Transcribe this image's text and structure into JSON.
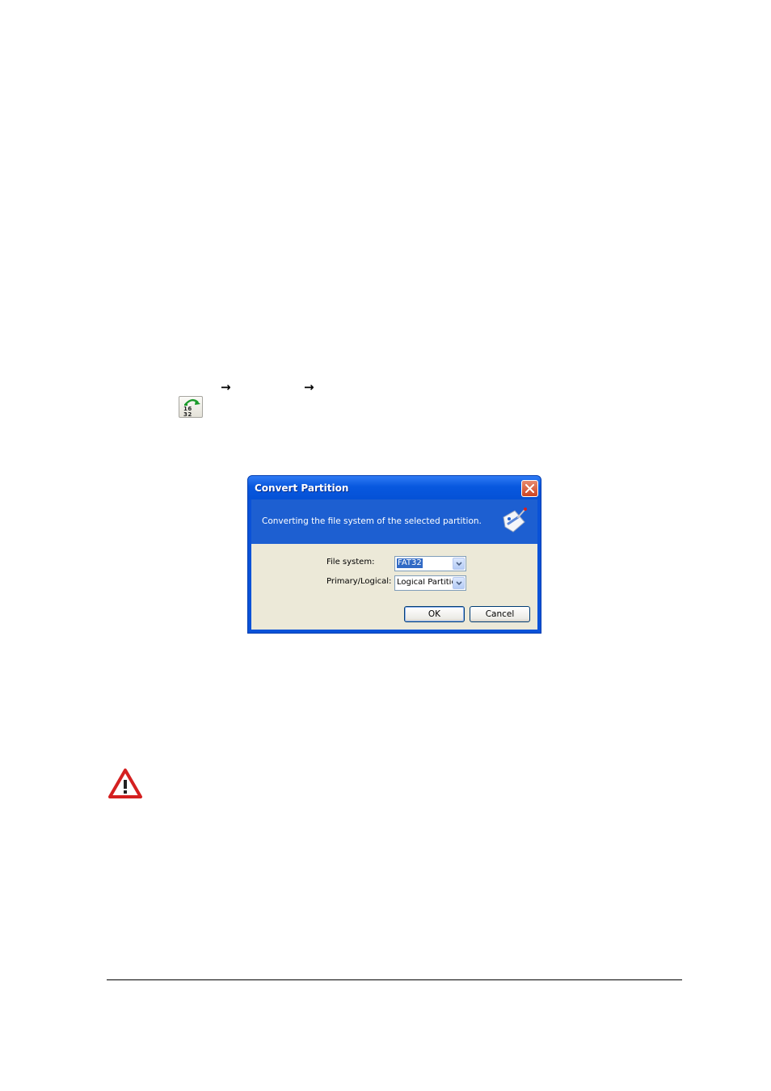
{
  "document": {
    "nav_arrow_1": "→",
    "nav_arrow_2": "→",
    "toolbar_icon": {
      "name": "convert-fat16-fat32-icon",
      "label": "16 32",
      "color": "#1a9a2a"
    },
    "warning_icon": {
      "name": "warning-triangle-icon",
      "color": "#d42020"
    }
  },
  "dialog": {
    "title": "Convert Partition",
    "description": "Converting the file system of the selected partition.",
    "close_icon": "close-icon",
    "header_icon": "tag-brush-icon",
    "fields": {
      "file_system": {
        "label": "File system:",
        "access_key": "F",
        "value": "FAT32"
      },
      "primary_logical": {
        "label": "Primary/Logical:",
        "access_key": "P",
        "value": "Logical Partition"
      }
    },
    "buttons": {
      "ok": "OK",
      "cancel": "Cancel"
    },
    "colors": {
      "titlebar": "#0858df",
      "header": "#1d5fd1",
      "body": "#ece9d8",
      "selection": "#316ac5"
    }
  }
}
